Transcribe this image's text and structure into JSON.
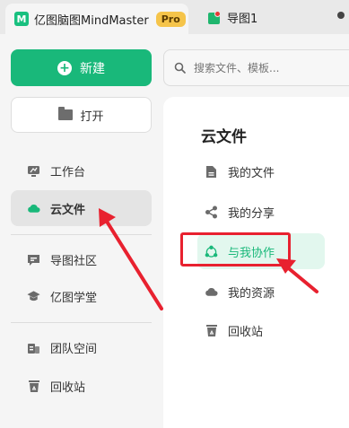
{
  "tabs": {
    "app_title": "亿图脑图MindMaster",
    "pro_badge": "Pro",
    "document_title": "导图1"
  },
  "sidebar": {
    "new_label": "新建",
    "open_label": "打开",
    "items": [
      {
        "label": "工作台",
        "icon": "monitor-icon"
      },
      {
        "label": "云文件",
        "icon": "cloud-icon",
        "selected": true
      },
      {
        "label": "导图社区",
        "icon": "community-icon"
      },
      {
        "label": "亿图学堂",
        "icon": "graduation-cap-icon"
      },
      {
        "label": "团队空间",
        "icon": "team-space-icon"
      },
      {
        "label": "回收站",
        "icon": "trash-icon"
      }
    ]
  },
  "search": {
    "placeholder": "搜索文件、模板..."
  },
  "cloud_panel": {
    "title": "云文件",
    "items": [
      {
        "label": "我的文件",
        "icon": "file-icon"
      },
      {
        "label": "我的分享",
        "icon": "share-icon"
      },
      {
        "label": "与我协作",
        "icon": "collaborate-icon",
        "selected": true
      },
      {
        "label": "我的资源",
        "icon": "cloud-resource-icon"
      },
      {
        "label": "回收站",
        "icon": "trash-icon"
      }
    ]
  },
  "colors": {
    "accent": "#19b87a",
    "annotation": "#e8212f"
  }
}
